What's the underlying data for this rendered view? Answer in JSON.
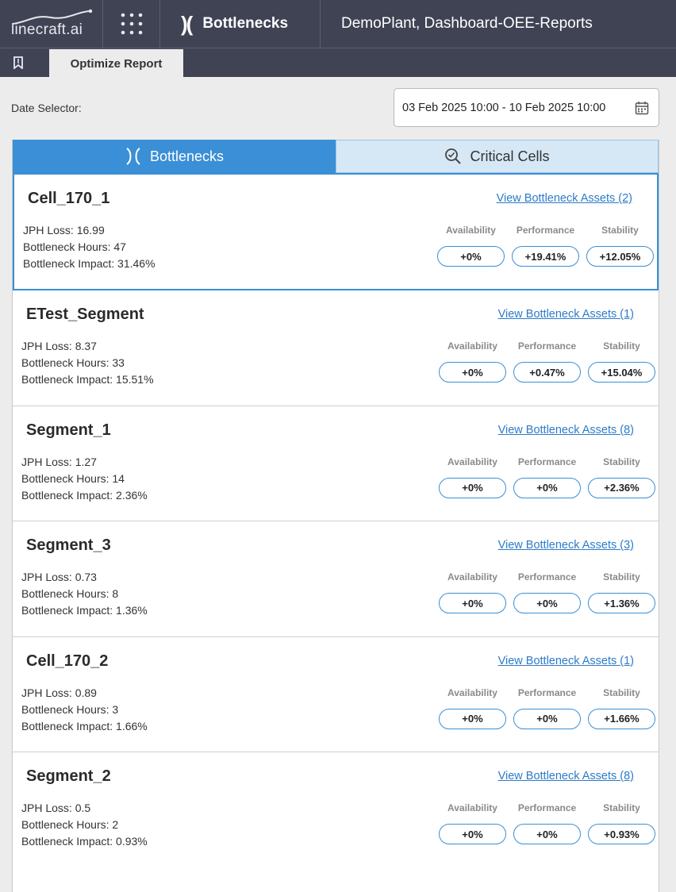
{
  "header": {
    "logo_text": "linecraft.ai",
    "module_icon": ")(",
    "module_label": "Bottlenecks",
    "plant_title": "DemoPlant, Dashboard-OEE-Reports"
  },
  "tabstrip": {
    "bookmark_icon": "bookmark-icon",
    "active_tab": "Optimize Report"
  },
  "date_selector": {
    "label": "Date Selector:",
    "value": "03 Feb 2025 10:00 - 10 Feb 2025 10:00",
    "icon": "calendar-icon"
  },
  "view_tabs": [
    {
      "label": "Bottlenecks",
      "icon": "bottleneck-icon",
      "active": true
    },
    {
      "label": "Critical Cells",
      "icon": "magnify-check-icon",
      "active": false
    }
  ],
  "kpi_labels": {
    "availability": "Availability",
    "performance": "Performance",
    "stability": "Stability"
  },
  "colors": {
    "accent": "#3a8fd6",
    "topbar": "#3f4354",
    "link": "#2d7bc9"
  },
  "cards": [
    {
      "title": "Cell_170_1",
      "link": "View Bottleneck Assets (2)",
      "jph": "JPH Loss: 16.99",
      "hours": "Bottleneck Hours: 47",
      "impact": "Bottleneck Impact: 31.46%",
      "availability": "+0%",
      "performance": "+19.41%",
      "stability": "+12.05%"
    },
    {
      "title": "ETest_Segment",
      "link": "View Bottleneck Assets (1)",
      "jph": "JPH Loss: 8.37",
      "hours": "Bottleneck Hours: 33",
      "impact": "Bottleneck Impact: 15.51%",
      "availability": "+0%",
      "performance": "+0.47%",
      "stability": "+15.04%"
    },
    {
      "title": "Segment_1",
      "link": "View Bottleneck Assets (8)",
      "jph": "JPH Loss: 1.27",
      "hours": "Bottleneck Hours: 14",
      "impact": "Bottleneck Impact: 2.36%",
      "availability": "+0%",
      "performance": "+0%",
      "stability": "+2.36%"
    },
    {
      "title": "Segment_3",
      "link": "View Bottleneck Assets (3)",
      "jph": "JPH Loss: 0.73",
      "hours": "Bottleneck Hours: 8",
      "impact": "Bottleneck Impact: 1.36%",
      "availability": "+0%",
      "performance": "+0%",
      "stability": "+1.36%"
    },
    {
      "title": "Cell_170_2",
      "link": "View Bottleneck Assets (1)",
      "jph": "JPH Loss: 0.89",
      "hours": "Bottleneck Hours: 3",
      "impact": "Bottleneck Impact: 1.66%",
      "availability": "+0%",
      "performance": "+0%",
      "stability": "+1.66%"
    },
    {
      "title": "Segment_2",
      "link": "View Bottleneck Assets (8)",
      "jph": "JPH Loss: 0.5",
      "hours": "Bottleneck Hours: 2",
      "impact": "Bottleneck Impact: 0.93%",
      "availability": "+0%",
      "performance": "+0%",
      "stability": "+0.93%"
    }
  ]
}
